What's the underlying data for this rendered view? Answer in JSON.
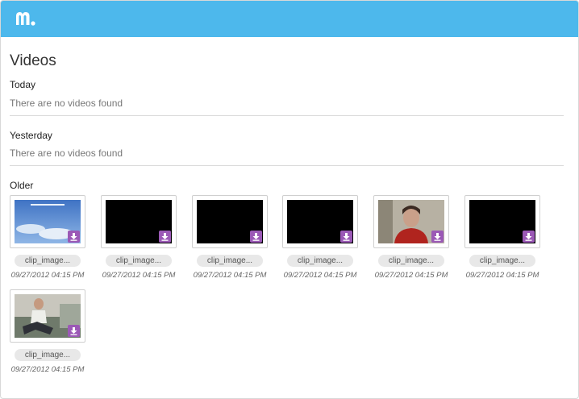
{
  "header": {
    "brand_color": "#4db8ec",
    "logo_icon": "mobizen-m-logo"
  },
  "page": {
    "title": "Videos"
  },
  "sections": {
    "today": {
      "label": "Today",
      "empty": "There are no videos found"
    },
    "yesterday": {
      "label": "Yesterday",
      "empty": "There are no videos found"
    },
    "older": {
      "label": "Older"
    }
  },
  "videos": [
    {
      "name": "clip_image...",
      "time": "09/27/2012 04:15 PM",
      "thumb": "sky"
    },
    {
      "name": "clip_image...",
      "time": "09/27/2012 04:15 PM",
      "thumb": "black"
    },
    {
      "name": "clip_image...",
      "time": "09/27/2012 04:15 PM",
      "thumb": "black"
    },
    {
      "name": "clip_image...",
      "time": "09/27/2012 04:15 PM",
      "thumb": "black"
    },
    {
      "name": "clip_image...",
      "time": "09/27/2012 04:15 PM",
      "thumb": "person-red"
    },
    {
      "name": "clip_image...",
      "time": "09/27/2012 04:15 PM",
      "thumb": "black"
    },
    {
      "name": "clip_image...",
      "time": "09/27/2012 04:15 PM",
      "thumb": "person-sofa"
    }
  ],
  "colors": {
    "download_badge": "#9b59b6"
  }
}
